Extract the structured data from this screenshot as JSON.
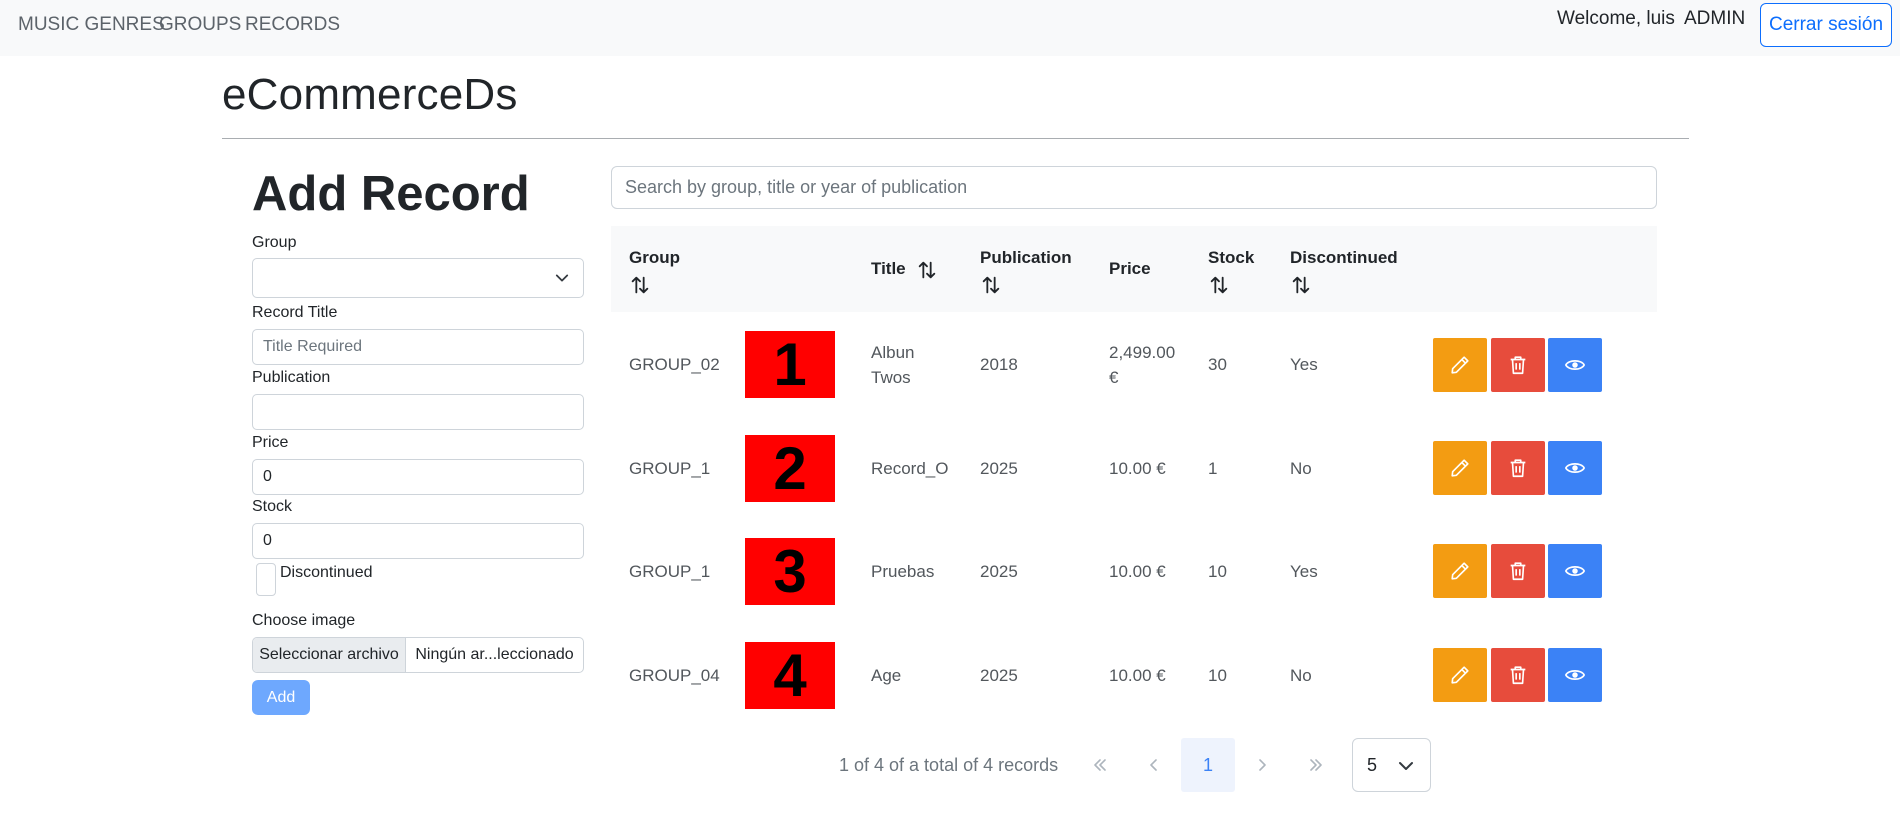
{
  "nav": {
    "links": [
      "MUSIC GENRES",
      "GROUPS",
      "RECORDS"
    ],
    "welcome": "Welcome, luis",
    "role": "ADMIN",
    "logout": "Cerrar sesión"
  },
  "brand": "eCommerceDs",
  "form": {
    "title": "Add Record",
    "group_label": "Group",
    "group_value": "",
    "title_label": "Record Title",
    "title_placeholder": "Title Required",
    "publication_label": "Publication",
    "publication_value": "",
    "price_label": "Price",
    "price_value": "0",
    "stock_label": "Stock",
    "stock_value": "0",
    "discontinued_label": "Discontinued",
    "discontinued_checked": false,
    "image_label": "Choose image",
    "file_button": "Seleccionar archivo",
    "file_name": "Ningún ar...leccionado",
    "add_button": "Add"
  },
  "search": {
    "placeholder": "Search by group, title or year of publication"
  },
  "table": {
    "headers": {
      "group": "Group",
      "title": "Title",
      "publication": "Publication",
      "price": "Price",
      "stock": "Stock",
      "discontinued": "Discontinued"
    },
    "rows": [
      {
        "group": "GROUP_02",
        "thumb": "1",
        "title_line1": "Albun",
        "title_line2": "Twos",
        "publication": "2018",
        "price_line1": "2,499.00",
        "price_line2": "€",
        "stock": "30",
        "discontinued": "Yes"
      },
      {
        "group": "GROUP_1",
        "thumb": "2",
        "title_line1": "Record_O",
        "title_line2": "",
        "publication": "2025",
        "price_line1": "10.00 €",
        "price_line2": "",
        "stock": "1",
        "discontinued": "No"
      },
      {
        "group": "GROUP_1",
        "thumb": "3",
        "title_line1": "Pruebas",
        "title_line2": "",
        "publication": "2025",
        "price_line1": "10.00 €",
        "price_line2": "",
        "stock": "10",
        "discontinued": "Yes"
      },
      {
        "group": "GROUP_04",
        "thumb": "4",
        "title_line1": "Age",
        "title_line2": "",
        "publication": "2025",
        "price_line1": "10.00 €",
        "price_line2": "",
        "stock": "10",
        "discontinued": "No"
      }
    ]
  },
  "pagination": {
    "summary": "1 of 4 of a total of 4 records",
    "first": "«",
    "prev": "‹",
    "current": "1",
    "next": "›",
    "last": "»",
    "page_size": "5"
  },
  "colors": {
    "edit": "#f39c12",
    "delete": "#e74c3c",
    "view": "#3b82f6",
    "thumb": "#ff0000",
    "accent": "#0d6efd"
  }
}
